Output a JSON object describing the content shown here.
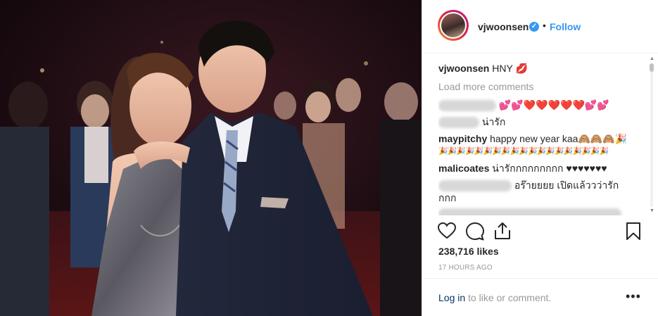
{
  "post": {
    "username": "vjwoonsen",
    "verified": true,
    "separator": "•",
    "follow_label": "Follow",
    "caption": {
      "username": "vjwoonsen",
      "text": "HNY 💋"
    },
    "load_more_label": "Load more comments",
    "comments": [
      {
        "username": "",
        "text": "💕💕❤️❤️❤️❤️❤️💕💕"
      },
      {
        "username": "",
        "text": "น่ารัก"
      },
      {
        "username": "maypitchy",
        "text": "happy new year kaa🙈🙈🙈🎉"
      },
      {
        "username": "",
        "text": "🎉🎉🎉🎉🎉🎉🎉🎉🎉🎉🎉🎉🎉🎉🎉🎉🎉🎉🎉"
      },
      {
        "username": "malicoates",
        "text": "น่ารักกกกกกกกก ♥♥♥♥♥♥♥"
      },
      {
        "username": "",
        "text": "อร๊ายยยย เปิดแล้ววว่ารัก"
      },
      {
        "username": "",
        "text": "กกก"
      }
    ],
    "likes_label": "238,716 likes",
    "timestamp": "17 HOURS AGO",
    "login_link": "Log in",
    "login_rest": "to like or comment.",
    "more_label": "•••"
  },
  "icons": {
    "like": "heart-icon",
    "comment": "comment-icon",
    "share": "share-icon",
    "save": "bookmark-icon",
    "verified": "verified-badge-icon",
    "more": "more-options-icon"
  },
  "colors": {
    "link_blue": "#3897f0",
    "text": "#262626",
    "muted": "#999999",
    "border": "#efefef",
    "login_link": "#003569"
  }
}
